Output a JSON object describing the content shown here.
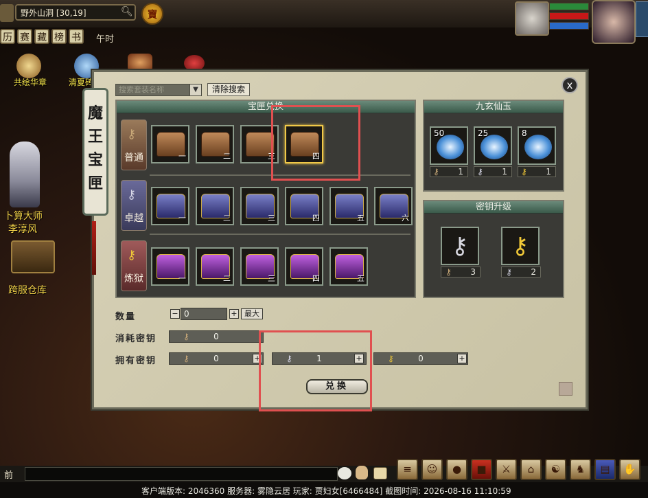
{
  "top": {
    "location": "野外山洞 [30,19]",
    "bao_icon_label": "寶",
    "menu": [
      "历",
      "赛",
      "藏",
      "榜",
      "书"
    ],
    "time_label": "午时"
  },
  "side": {
    "item1": "共绘华章",
    "item2": "清夏砖",
    "npc_name": "卜算大师",
    "npc_sub": "李淳风",
    "warehouse": "跨服仓库"
  },
  "panel": {
    "title_chars": [
      "魔",
      "王",
      "宝",
      "匣"
    ],
    "search_placeholder": "搜索套装名称",
    "clear_search": "清除搜索",
    "box_section_title": "宝匣兑换",
    "close_label": "x",
    "rows": [
      {
        "label": "普通",
        "slots": [
          "一",
          "二",
          "三",
          "四"
        ],
        "selected": 3
      },
      {
        "label": "卓越",
        "slots": [
          "一",
          "二",
          "三",
          "四",
          "五",
          "六"
        ]
      },
      {
        "label": "炼狱",
        "slots": [
          "一",
          "二",
          "三",
          "四",
          "五"
        ]
      }
    ],
    "jiuxuan": {
      "title": "九玄仙玉",
      "items": [
        {
          "count": "50",
          "cost": "1"
        },
        {
          "count": "25",
          "cost": "1"
        },
        {
          "count": "8",
          "cost": "1"
        }
      ]
    },
    "upgrade": {
      "title": "密钥升级",
      "items": [
        {
          "cost": "3"
        },
        {
          "cost": "2"
        }
      ]
    },
    "quantity_label": "数量",
    "quantity_value": "0",
    "minus": "−",
    "plus": "+",
    "max_label": "最大",
    "consume_label": "消耗密钥",
    "consume_value": "0",
    "own_label": "拥有密钥",
    "own_values": [
      "0",
      "1",
      "0"
    ],
    "exchange_label": "兑换"
  },
  "chat": {
    "prefix": "前"
  },
  "status": "客户端版本: 2046360  服务器: 雾隐云居  玩家: 贾妇女[6466484]  截图时间: 2026-08-16  11:10:59",
  "colors": {
    "highlight": "#e05050",
    "selected_slot": "#f0c848"
  }
}
